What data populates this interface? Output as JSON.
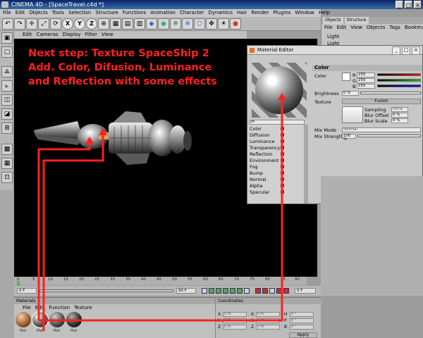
{
  "window": {
    "title": "CINEMA 4D - [SpaceTravel.c4d *]",
    "buttons": [
      "_",
      "□",
      "×"
    ]
  },
  "menubar": [
    "File",
    "Edit",
    "Objects",
    "Tools",
    "Selection",
    "Structure",
    "Functions",
    "Animation",
    "Character",
    "Dynamics",
    "Hair",
    "Render",
    "Plugins",
    "Window",
    "Help"
  ],
  "toolbar_icons": [
    "undo-icon",
    "redo-icon",
    "move-icon",
    "scale-icon",
    "rotate-icon",
    "x-axis-icon",
    "y-axis-icon",
    "z-axis-icon",
    "world-coord-icon",
    "render-view-icon",
    "render-picture-icon",
    "render-settings-icon",
    "cube-icon",
    "nurbs-icon",
    "spline-icon",
    "deformer-icon",
    "scene-icon",
    "light-icon",
    "camera-icon",
    "bulb-icon"
  ],
  "toolbar_xyz": [
    "X",
    "Y",
    "Z"
  ],
  "viewport": {
    "menu": [
      "Edit",
      "Cameras",
      "Display",
      "Filter",
      "View"
    ]
  },
  "annotation": {
    "lines": [
      "Next step: Texture SpaceShip 2",
      "Add. Color, Difusion, Luminance",
      "and Reflection with some effects"
    ],
    "color": "#ff2020"
  },
  "object_manager": {
    "tabs": [
      "Objects",
      "Structure"
    ],
    "menu": [
      "File",
      "Edit",
      "View",
      "Objects",
      "Tags",
      "Bookmarks"
    ],
    "items": [
      "Light",
      "Light"
    ]
  },
  "material_editor": {
    "title": "Material Editor",
    "name_field": "m",
    "channels": [
      "Color",
      "Diffusion",
      "Luminance",
      "Transparency",
      "Reflection",
      "Environment",
      "Fog",
      "Bump",
      "Normal",
      "Alpha",
      "Specular"
    ],
    "section": "Color",
    "color_label": "Color",
    "r": {
      "label": "R",
      "value": "255"
    },
    "g": {
      "label": "G",
      "value": "255"
    },
    "b": {
      "label": "B",
      "value": "255"
    },
    "brightness": {
      "label": "Brightness",
      "value": "0 %"
    },
    "texture": {
      "label": "Texture",
      "button": "Fusion"
    },
    "sampling": {
      "label": "Sampling",
      "value": "None"
    },
    "blur_offset": {
      "label": "Blur Offset",
      "value": "0 %"
    },
    "blur_scale": {
      "label": "Blur Scale",
      "value": "0 %"
    },
    "mix_mode": {
      "label": "Mix Mode",
      "value": "Normal"
    },
    "mix_strength": {
      "label": "Mix Strength",
      "value": "100 %"
    }
  },
  "timeline": {
    "ticks": [
      "0",
      "5",
      "10",
      "15",
      "20",
      "25",
      "30",
      "35",
      "40",
      "45",
      "50",
      "55",
      "60",
      "65",
      "70",
      "75",
      "80",
      "85",
      "90"
    ],
    "start": "0 F",
    "end": "90 F",
    "current": "0 F"
  },
  "materials_panel": {
    "title": "Materials",
    "menu": [
      "File",
      "Edit",
      "Function",
      "Texture"
    ],
    "labels": [
      "Mat",
      "Mat",
      "Mat",
      "Mat"
    ]
  },
  "coordinates_panel": {
    "title": "Coordinates",
    "rows": [
      {
        "a": "X",
        "av": "0 m",
        "b": "X",
        "bv": "0 m",
        "c": "H",
        "cv": "0 °"
      },
      {
        "a": "Y",
        "av": "0 m",
        "b": "Y",
        "bv": "0 m",
        "c": "P",
        "cv": "0 °"
      },
      {
        "a": "Z",
        "av": "0 m",
        "b": "Z",
        "bv": "0 m",
        "c": "B",
        "cv": "0 °"
      }
    ],
    "apply": "Apply"
  },
  "colors": {
    "accent": "#ff2020",
    "titlebar": "#0a246a"
  }
}
